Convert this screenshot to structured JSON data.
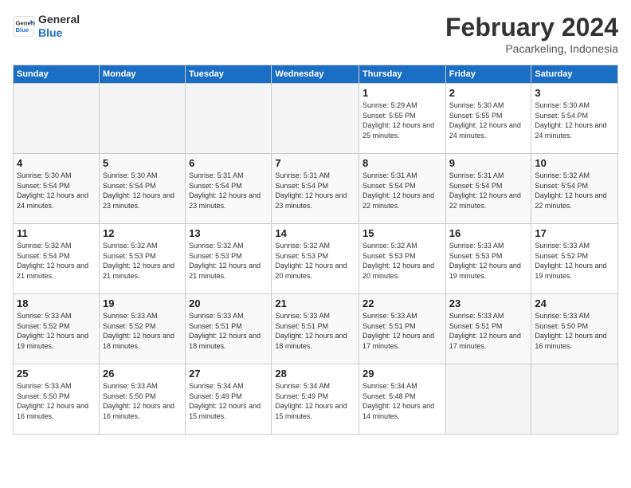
{
  "logo": {
    "line1": "General",
    "line2": "Blue"
  },
  "title": "February 2024",
  "subtitle": "Pacarkeling, Indonesia",
  "days_header": [
    "Sunday",
    "Monday",
    "Tuesday",
    "Wednesday",
    "Thursday",
    "Friday",
    "Saturday"
  ],
  "weeks": [
    [
      {
        "day": "",
        "empty": true
      },
      {
        "day": "",
        "empty": true
      },
      {
        "day": "",
        "empty": true
      },
      {
        "day": "",
        "empty": true
      },
      {
        "day": "1",
        "sunrise": "5:29 AM",
        "sunset": "5:55 PM",
        "daylight": "12 hours and 25 minutes."
      },
      {
        "day": "2",
        "sunrise": "5:30 AM",
        "sunset": "5:55 PM",
        "daylight": "12 hours and 24 minutes."
      },
      {
        "day": "3",
        "sunrise": "5:30 AM",
        "sunset": "5:54 PM",
        "daylight": "12 hours and 24 minutes."
      }
    ],
    [
      {
        "day": "4",
        "sunrise": "5:30 AM",
        "sunset": "5:54 PM",
        "daylight": "12 hours and 24 minutes."
      },
      {
        "day": "5",
        "sunrise": "5:30 AM",
        "sunset": "5:54 PM",
        "daylight": "12 hours and 23 minutes."
      },
      {
        "day": "6",
        "sunrise": "5:31 AM",
        "sunset": "5:54 PM",
        "daylight": "12 hours and 23 minutes."
      },
      {
        "day": "7",
        "sunrise": "5:31 AM",
        "sunset": "5:54 PM",
        "daylight": "12 hours and 23 minutes."
      },
      {
        "day": "8",
        "sunrise": "5:31 AM",
        "sunset": "5:54 PM",
        "daylight": "12 hours and 22 minutes."
      },
      {
        "day": "9",
        "sunrise": "5:31 AM",
        "sunset": "5:54 PM",
        "daylight": "12 hours and 22 minutes."
      },
      {
        "day": "10",
        "sunrise": "5:32 AM",
        "sunset": "5:54 PM",
        "daylight": "12 hours and 22 minutes."
      }
    ],
    [
      {
        "day": "11",
        "sunrise": "5:32 AM",
        "sunset": "5:54 PM",
        "daylight": "12 hours and 21 minutes."
      },
      {
        "day": "12",
        "sunrise": "5:32 AM",
        "sunset": "5:53 PM",
        "daylight": "12 hours and 21 minutes."
      },
      {
        "day": "13",
        "sunrise": "5:32 AM",
        "sunset": "5:53 PM",
        "daylight": "12 hours and 21 minutes."
      },
      {
        "day": "14",
        "sunrise": "5:32 AM",
        "sunset": "5:53 PM",
        "daylight": "12 hours and 20 minutes."
      },
      {
        "day": "15",
        "sunrise": "5:32 AM",
        "sunset": "5:53 PM",
        "daylight": "12 hours and 20 minutes."
      },
      {
        "day": "16",
        "sunrise": "5:33 AM",
        "sunset": "5:53 PM",
        "daylight": "12 hours and 19 minutes."
      },
      {
        "day": "17",
        "sunrise": "5:33 AM",
        "sunset": "5:52 PM",
        "daylight": "12 hours and 19 minutes."
      }
    ],
    [
      {
        "day": "18",
        "sunrise": "5:33 AM",
        "sunset": "5:52 PM",
        "daylight": "12 hours and 19 minutes."
      },
      {
        "day": "19",
        "sunrise": "5:33 AM",
        "sunset": "5:52 PM",
        "daylight": "12 hours and 18 minutes."
      },
      {
        "day": "20",
        "sunrise": "5:33 AM",
        "sunset": "5:51 PM",
        "daylight": "12 hours and 18 minutes."
      },
      {
        "day": "21",
        "sunrise": "5:33 AM",
        "sunset": "5:51 PM",
        "daylight": "12 hours and 18 minutes."
      },
      {
        "day": "22",
        "sunrise": "5:33 AM",
        "sunset": "5:51 PM",
        "daylight": "12 hours and 17 minutes."
      },
      {
        "day": "23",
        "sunrise": "5:33 AM",
        "sunset": "5:51 PM",
        "daylight": "12 hours and 17 minutes."
      },
      {
        "day": "24",
        "sunrise": "5:33 AM",
        "sunset": "5:50 PM",
        "daylight": "12 hours and 16 minutes."
      }
    ],
    [
      {
        "day": "25",
        "sunrise": "5:33 AM",
        "sunset": "5:50 PM",
        "daylight": "12 hours and 16 minutes."
      },
      {
        "day": "26",
        "sunrise": "5:33 AM",
        "sunset": "5:50 PM",
        "daylight": "12 hours and 16 minutes."
      },
      {
        "day": "27",
        "sunrise": "5:34 AM",
        "sunset": "5:49 PM",
        "daylight": "12 hours and 15 minutes."
      },
      {
        "day": "28",
        "sunrise": "5:34 AM",
        "sunset": "5:49 PM",
        "daylight": "12 hours and 15 minutes."
      },
      {
        "day": "29",
        "sunrise": "5:34 AM",
        "sunset": "5:48 PM",
        "daylight": "12 hours and 14 minutes."
      },
      {
        "day": "",
        "empty": true
      },
      {
        "day": "",
        "empty": true
      }
    ]
  ]
}
